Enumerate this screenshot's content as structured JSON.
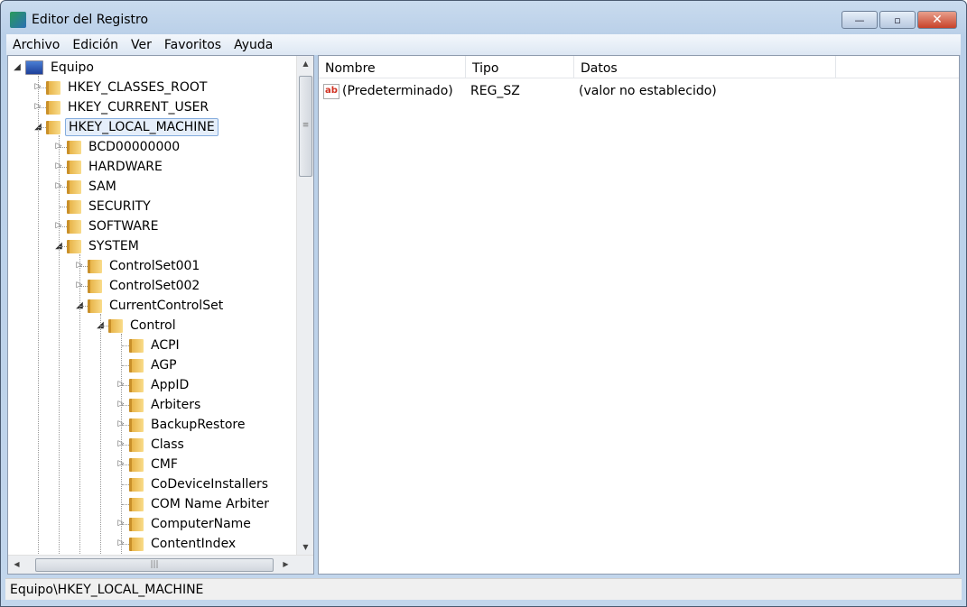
{
  "window": {
    "title": "Editor del Registro",
    "minimize": "—",
    "maximize": "▫",
    "close": "✕"
  },
  "menu": [
    "Archivo",
    "Edición",
    "Ver",
    "Favoritos",
    "Ayuda"
  ],
  "tree": [
    {
      "label": "Equipo",
      "level": 0,
      "exp": "open",
      "icon": "computer"
    },
    {
      "label": "HKEY_CLASSES_ROOT",
      "level": 1,
      "exp": "closed"
    },
    {
      "label": "HKEY_CURRENT_USER",
      "level": 1,
      "exp": "closed"
    },
    {
      "label": "HKEY_LOCAL_MACHINE",
      "level": 1,
      "exp": "open",
      "selected": true
    },
    {
      "label": "BCD00000000",
      "level": 2,
      "exp": "closed"
    },
    {
      "label": "HARDWARE",
      "level": 2,
      "exp": "closed"
    },
    {
      "label": "SAM",
      "level": 2,
      "exp": "closed"
    },
    {
      "label": "SECURITY",
      "level": 2,
      "exp": "none"
    },
    {
      "label": "SOFTWARE",
      "level": 2,
      "exp": "closed"
    },
    {
      "label": "SYSTEM",
      "level": 2,
      "exp": "open"
    },
    {
      "label": "ControlSet001",
      "level": 3,
      "exp": "closed"
    },
    {
      "label": "ControlSet002",
      "level": 3,
      "exp": "closed"
    },
    {
      "label": "CurrentControlSet",
      "level": 3,
      "exp": "open"
    },
    {
      "label": "Control",
      "level": 4,
      "exp": "open"
    },
    {
      "label": "ACPI",
      "level": 5,
      "exp": "none"
    },
    {
      "label": "AGP",
      "level": 5,
      "exp": "none"
    },
    {
      "label": "AppID",
      "level": 5,
      "exp": "closed"
    },
    {
      "label": "Arbiters",
      "level": 5,
      "exp": "closed"
    },
    {
      "label": "BackupRestore",
      "level": 5,
      "exp": "closed"
    },
    {
      "label": "Class",
      "level": 5,
      "exp": "closed"
    },
    {
      "label": "CMF",
      "level": 5,
      "exp": "closed"
    },
    {
      "label": "CoDeviceInstallers",
      "level": 5,
      "exp": "none"
    },
    {
      "label": "COM Name Arbiter",
      "level": 5,
      "exp": "none"
    },
    {
      "label": "ComputerName",
      "level": 5,
      "exp": "closed"
    },
    {
      "label": "ContentIndex",
      "level": 5,
      "exp": "closed"
    }
  ],
  "list": {
    "columns": [
      "Nombre",
      "Tipo",
      "Datos"
    ],
    "rows": [
      {
        "name": "(Predeterminado)",
        "type": "REG_SZ",
        "data": "(valor no establecido)",
        "icon": "ab"
      }
    ]
  },
  "status": "Equipo\\HKEY_LOCAL_MACHINE"
}
